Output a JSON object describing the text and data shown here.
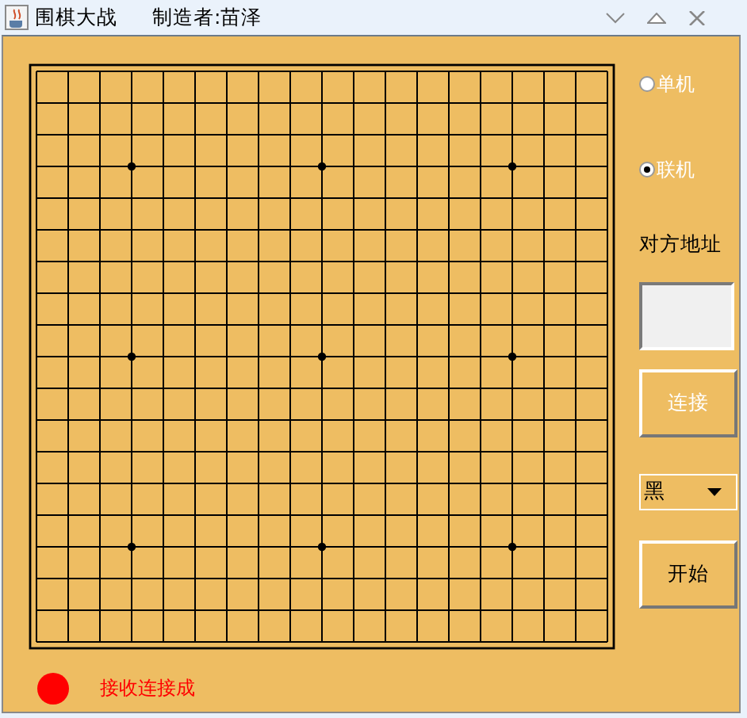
{
  "window": {
    "title": "围棋大战",
    "author": "制造者:苗泽"
  },
  "modes": [
    {
      "label": "单机",
      "selected": false
    },
    {
      "label": "联机",
      "selected": true
    }
  ],
  "address": {
    "label": "对方地址"
  },
  "connect_button": {
    "label": "连接",
    "disabled": true
  },
  "color_select": {
    "value": "黑"
  },
  "start_button": {
    "label": "开始",
    "disabled": false
  },
  "status": {
    "text": "接收连接成"
  }
}
